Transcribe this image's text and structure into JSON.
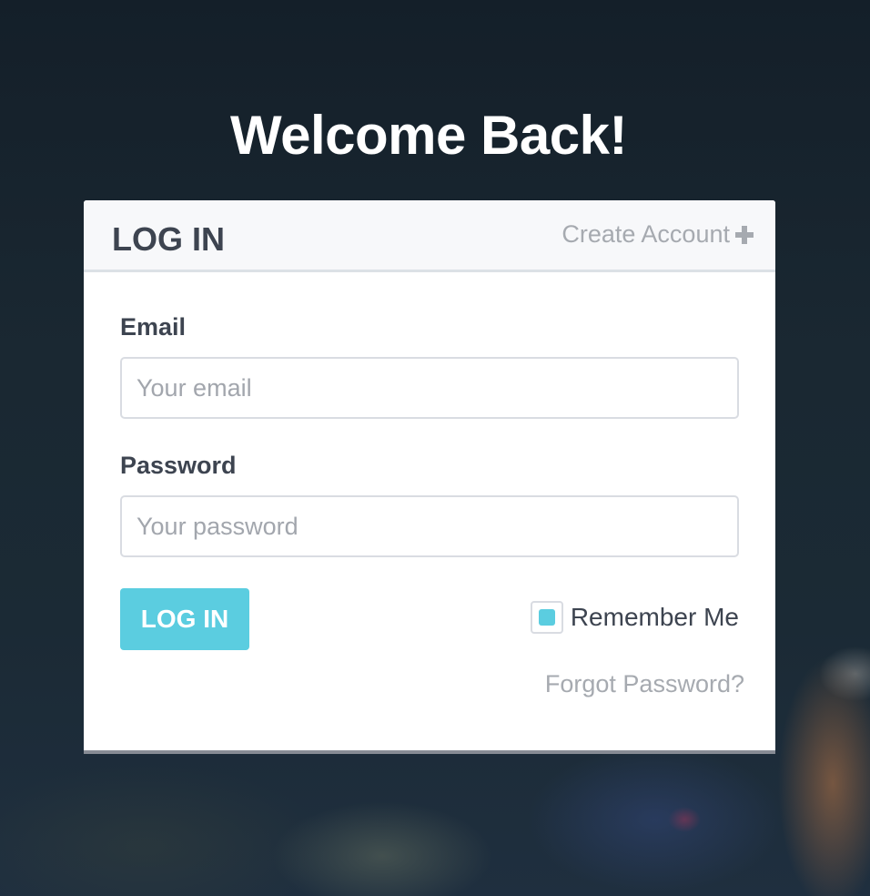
{
  "page": {
    "title": "Welcome Back!"
  },
  "card": {
    "heading": "LOG IN",
    "create_account_label": "Create Account",
    "create_account_icon": "plus-icon"
  },
  "form": {
    "email": {
      "label": "Email",
      "placeholder": "Your email",
      "value": ""
    },
    "password": {
      "label": "Password",
      "placeholder": "Your password",
      "value": ""
    },
    "submit_label": "LOG IN",
    "remember_me": {
      "label": "Remember Me",
      "checked": true
    },
    "forgot_password_label": "Forgot Password?"
  },
  "colors": {
    "accent": "#5bcde0",
    "heading_text": "#3d4450",
    "muted_text": "#a6aab0",
    "card_bottom_border": "#878b94"
  }
}
